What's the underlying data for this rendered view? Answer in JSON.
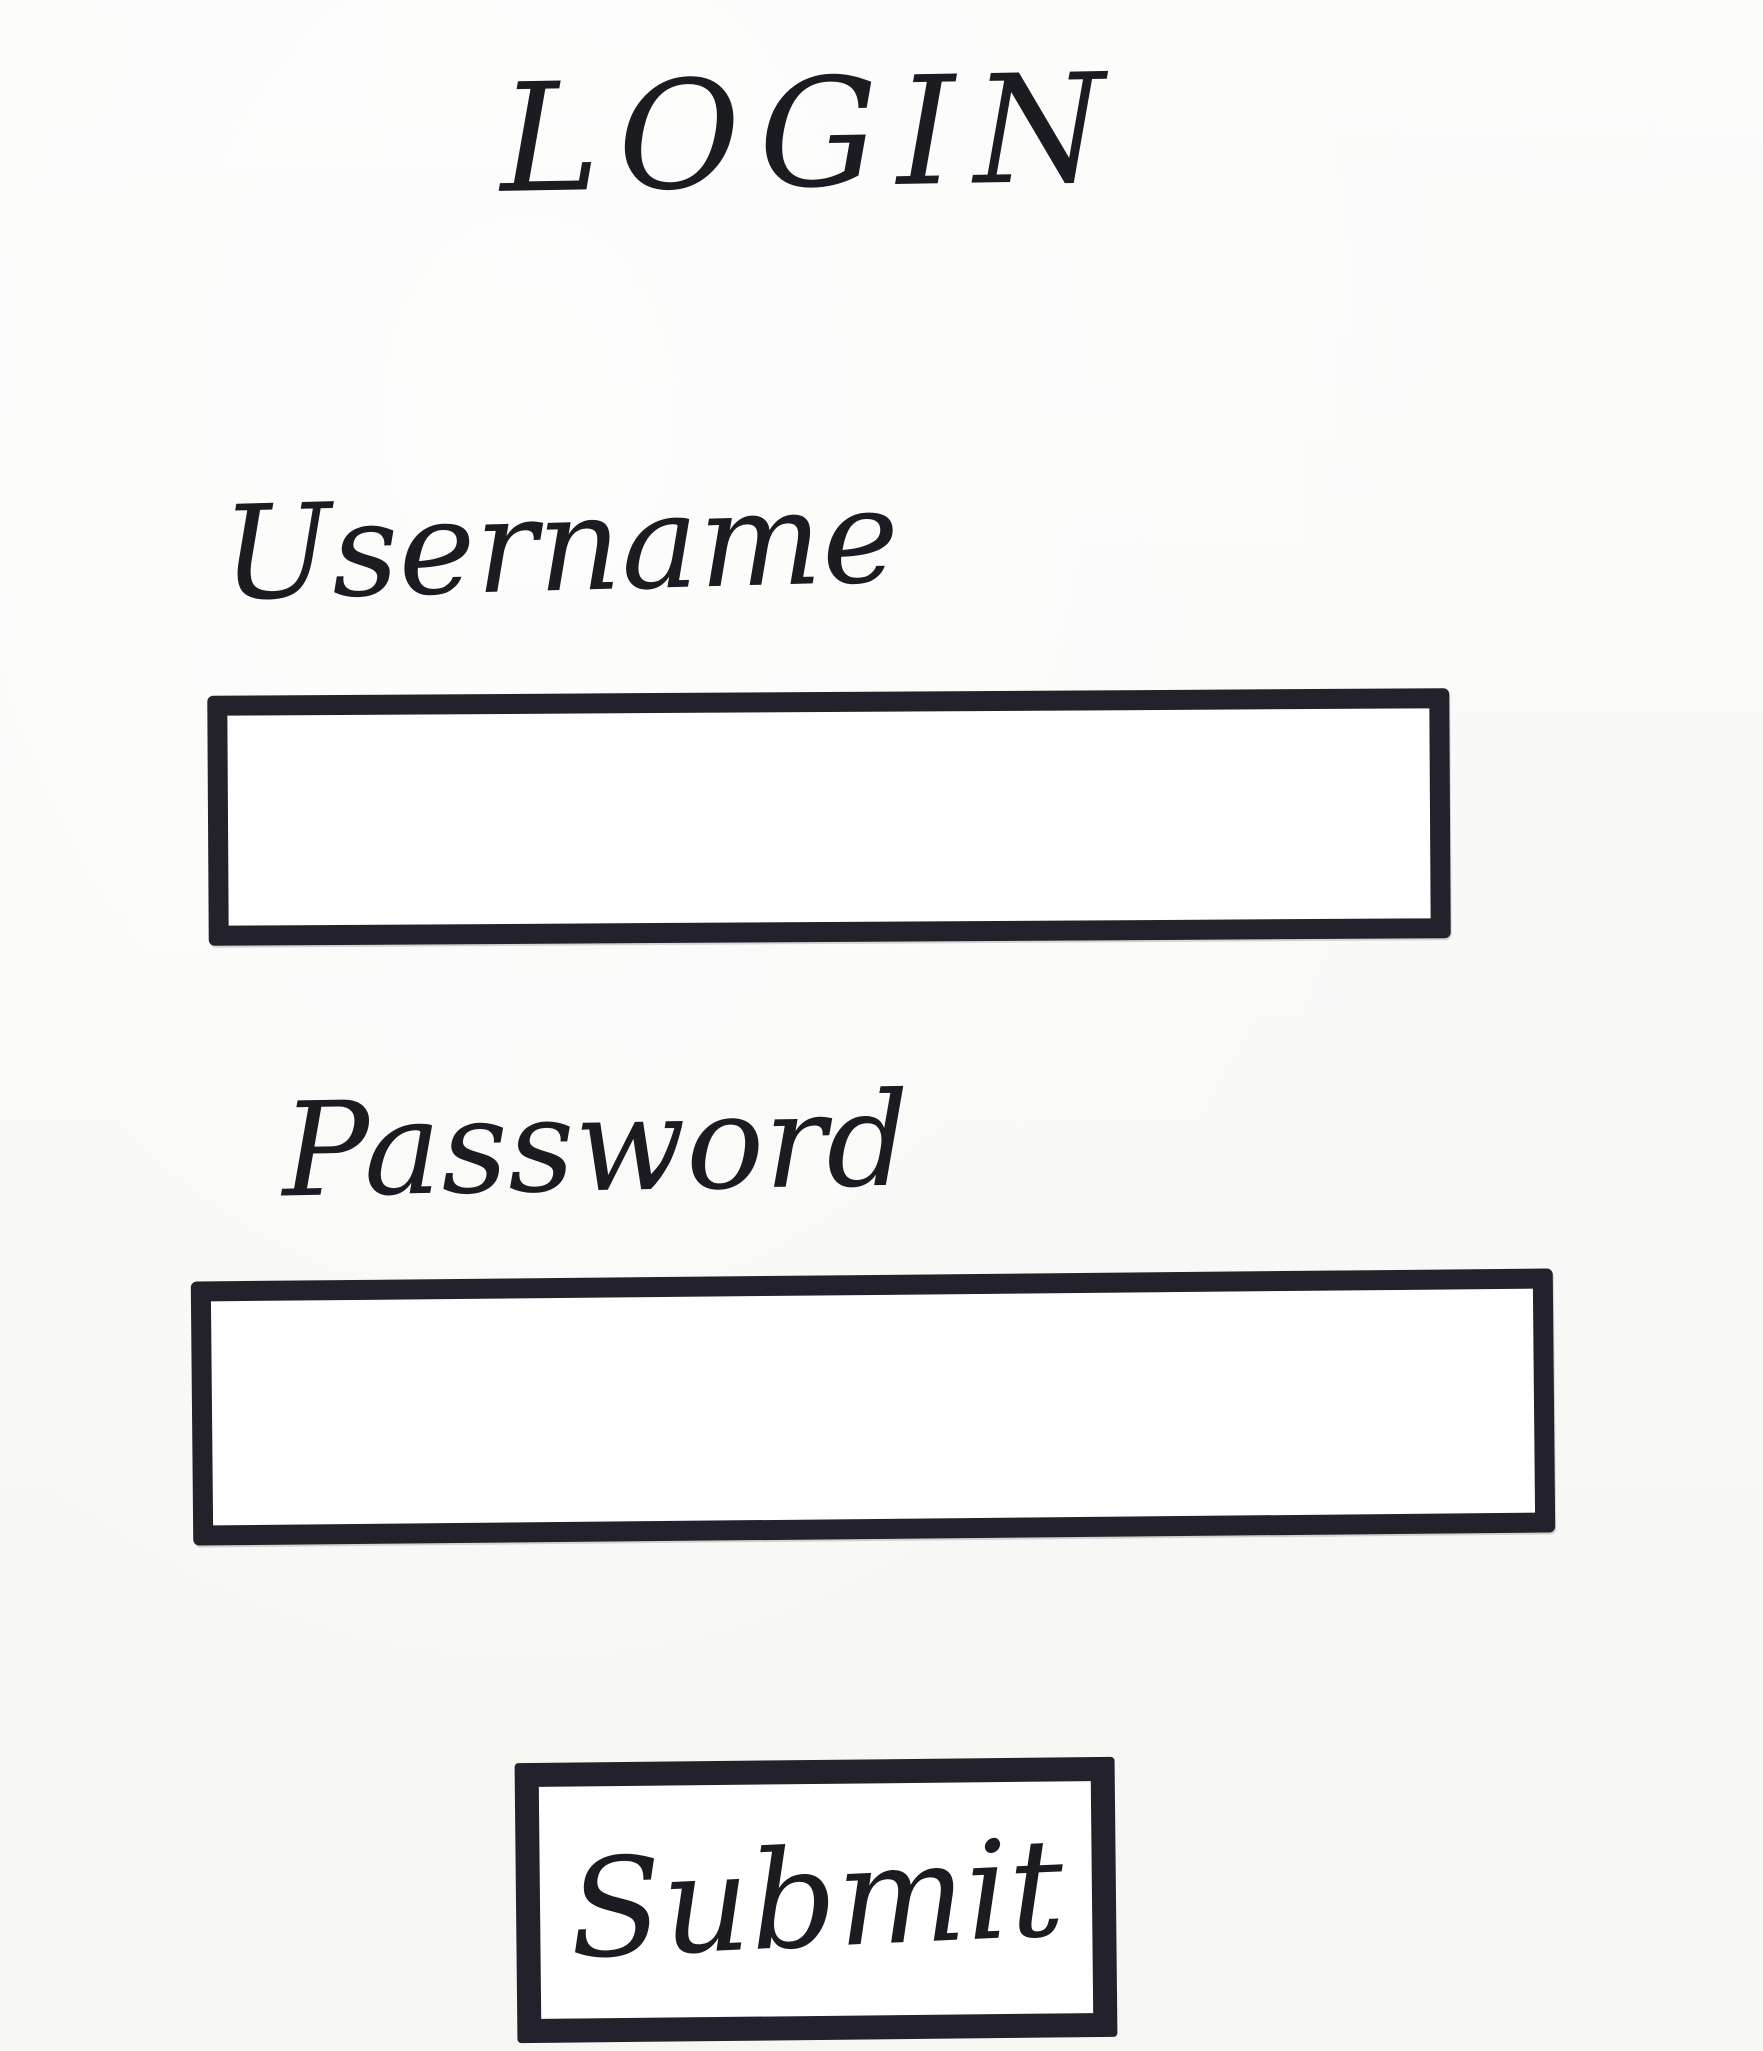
{
  "form": {
    "title": "LOGIN",
    "username_label": "Username",
    "username_value": "",
    "password_label": "Password",
    "password_value": "",
    "submit_label": "Submit"
  }
}
